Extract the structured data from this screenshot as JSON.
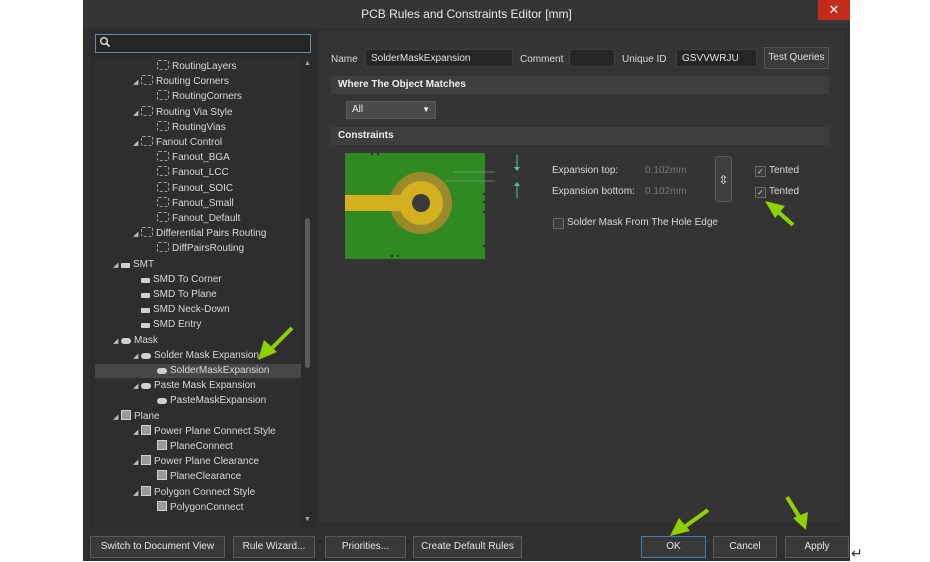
{
  "window": {
    "title": "PCB Rules and Constraints Editor [mm]",
    "close": "✕"
  },
  "search": {
    "placeholder": ""
  },
  "tree": [
    {
      "label": "RoutingLayers",
      "level": 2,
      "icon": "route",
      "expanded": null
    },
    {
      "label": "Routing Corners",
      "level": 1,
      "icon": "route",
      "expanded": true
    },
    {
      "label": "RoutingCorners",
      "level": 2,
      "icon": "route",
      "expanded": null
    },
    {
      "label": "Routing Via Style",
      "level": 1,
      "icon": "route",
      "expanded": true
    },
    {
      "label": "RoutingVias",
      "level": 2,
      "icon": "route",
      "expanded": null
    },
    {
      "label": "Fanout Control",
      "level": 1,
      "icon": "route",
      "expanded": true
    },
    {
      "label": "Fanout_BGA",
      "level": 2,
      "icon": "route",
      "expanded": null
    },
    {
      "label": "Fanout_LCC",
      "level": 2,
      "icon": "route",
      "expanded": null
    },
    {
      "label": "Fanout_SOIC",
      "level": 2,
      "icon": "route",
      "expanded": null
    },
    {
      "label": "Fanout_Small",
      "level": 2,
      "icon": "route",
      "expanded": null
    },
    {
      "label": "Fanout_Default",
      "level": 2,
      "icon": "route",
      "expanded": null
    },
    {
      "label": "Differential Pairs Routing",
      "level": 1,
      "icon": "route",
      "expanded": true
    },
    {
      "label": "DiffPairsRouting",
      "level": 2,
      "icon": "route",
      "expanded": null
    },
    {
      "label": "SMT",
      "level": 0,
      "icon": "smt",
      "expanded": true
    },
    {
      "label": "SMD To Corner",
      "level": 1,
      "icon": "smt",
      "expanded": null
    },
    {
      "label": "SMD To Plane",
      "level": 1,
      "icon": "smt",
      "expanded": null
    },
    {
      "label": "SMD Neck-Down",
      "level": 1,
      "icon": "smt",
      "expanded": null
    },
    {
      "label": "SMD Entry",
      "level": 1,
      "icon": "smt",
      "expanded": null
    },
    {
      "label": "Mask",
      "level": 0,
      "icon": "pill",
      "expanded": true
    },
    {
      "label": "Solder Mask Expansion",
      "level": 1,
      "icon": "pill",
      "expanded": true
    },
    {
      "label": "SolderMaskExpansion",
      "level": 2,
      "icon": "pill",
      "expanded": null,
      "selected": true
    },
    {
      "label": "Paste Mask Expansion",
      "level": 1,
      "icon": "pill",
      "expanded": true
    },
    {
      "label": "PasteMaskExpansion",
      "level": 2,
      "icon": "pill",
      "expanded": null
    },
    {
      "label": "Plane",
      "level": 0,
      "icon": "grid",
      "expanded": true
    },
    {
      "label": "Power Plane Connect Style",
      "level": 1,
      "icon": "grid",
      "expanded": true
    },
    {
      "label": "PlaneConnect",
      "level": 2,
      "icon": "grid",
      "expanded": null
    },
    {
      "label": "Power Plane Clearance",
      "level": 1,
      "icon": "grid",
      "expanded": true
    },
    {
      "label": "PlaneClearance",
      "level": 2,
      "icon": "grid",
      "expanded": null
    },
    {
      "label": "Polygon Connect Style",
      "level": 1,
      "icon": "grid",
      "expanded": true
    },
    {
      "label": "PolygonConnect",
      "level": 2,
      "icon": "grid",
      "expanded": null
    }
  ],
  "rule": {
    "name_label": "Name",
    "name_value": "SolderMaskExpansion",
    "comment_label": "Comment",
    "comment_value": "",
    "uid_label": "Unique ID",
    "uid_value": "GSVVWRJU",
    "test_queries": "Test Queries"
  },
  "where": {
    "header": "Where The Object Matches",
    "selected": "All"
  },
  "constraints": {
    "header": "Constraints",
    "expansion_top_label": "Expansion top:",
    "expansion_top_value": "0.102mm",
    "expansion_bottom_label": "Expansion bottom:",
    "expansion_bottom_value": "0.102mm",
    "tented_top_label": "Tented",
    "tented_top_checked": true,
    "tented_bottom_label": "Tented",
    "tented_bottom_checked": true,
    "hole_edge_label": "Solder Mask From The Hole Edge",
    "hole_edge_checked": false,
    "link_icon": "⇳"
  },
  "buttons": {
    "switch_view": "Switch to Document View",
    "rule_wizard": "Rule Wizard...",
    "priorities": "Priorities...",
    "create_default": "Create Default Rules",
    "ok": "OK",
    "cancel": "Cancel",
    "apply": "Apply"
  },
  "colors": {
    "annotation_arrow": "#8ed300",
    "board_green": "#2f8a21",
    "pad_gold": "#d4b020",
    "mask_ring": "#9a8a2a"
  }
}
